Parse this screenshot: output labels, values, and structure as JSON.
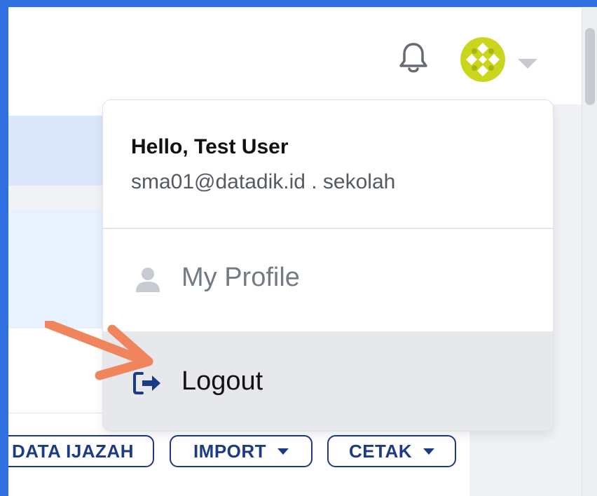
{
  "user_menu": {
    "greeting": "Hello, Test User",
    "account": "sma01@datadik.id . sekolah",
    "items": [
      {
        "label": "My Profile",
        "icon": "user-icon"
      },
      {
        "label": "Logout",
        "icon": "logout-icon"
      }
    ]
  },
  "toolbar": {
    "buttons": [
      {
        "label": "DATA IJAZAH"
      },
      {
        "label": "IMPORT"
      },
      {
        "label": "CETAK"
      }
    ]
  },
  "colors": {
    "frame": "#2f6fe0",
    "button_text": "#1d3a84",
    "highlight_arrow": "#f0845c",
    "avatar": "#c9d61b",
    "hovered_item": "#e6e8ec"
  }
}
